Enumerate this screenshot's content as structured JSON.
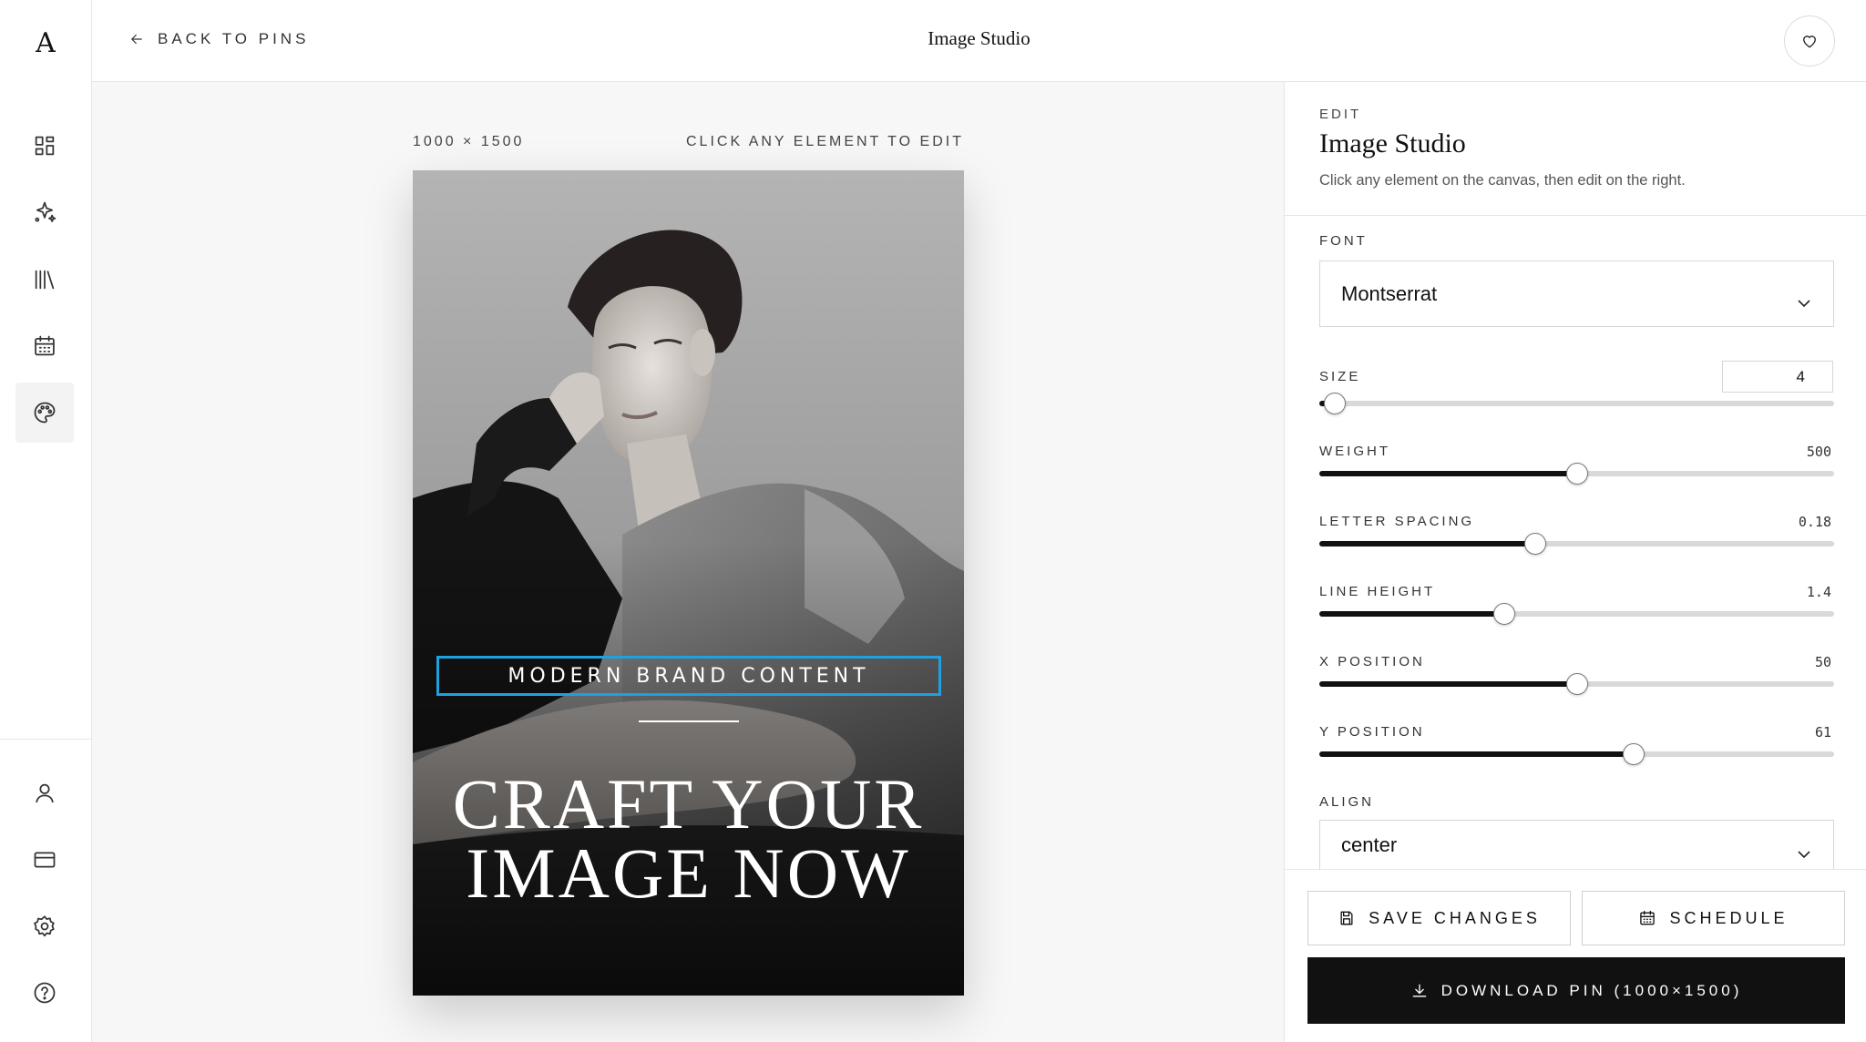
{
  "app": {
    "logo": "A",
    "title": "Image Studio",
    "back_label": "BACK TO PINS"
  },
  "sidebar": {
    "items": [
      {
        "name": "dashboard",
        "icon": "grid-icon"
      },
      {
        "name": "ai-generate",
        "icon": "sparkles-icon"
      },
      {
        "name": "library",
        "icon": "library-icon"
      },
      {
        "name": "calendar",
        "icon": "calendar-icon"
      },
      {
        "name": "image-studio",
        "icon": "palette-icon",
        "active": true
      }
    ],
    "bottom_items": [
      {
        "name": "profile",
        "icon": "user-icon"
      },
      {
        "name": "billing",
        "icon": "credit-card-icon"
      },
      {
        "name": "settings",
        "icon": "gear-icon"
      },
      {
        "name": "help",
        "icon": "help-icon"
      }
    ]
  },
  "canvas": {
    "size_label": "1000 × 1500",
    "hint": "CLICK ANY ELEMENT TO EDIT",
    "pin": {
      "subtitle": "MODERN BRAND CONTENT",
      "headline_line1": "CRAFT YOUR",
      "headline_line2": "IMAGE NOW",
      "selection_color": "#1da1e0"
    }
  },
  "panel": {
    "eyebrow": "EDIT",
    "title": "Image Studio",
    "description": "Click any element on the canvas, then edit on the right.",
    "font": {
      "label": "FONT",
      "value": "Montserrat"
    },
    "size": {
      "label": "SIZE",
      "value": "4",
      "fraction": 0.03
    },
    "weight": {
      "label": "WEIGHT",
      "value": "500",
      "fraction": 0.5
    },
    "letter_spacing": {
      "label": "LETTER SPACING",
      "value": "0.18",
      "fraction": 0.42
    },
    "line_height": {
      "label": "LINE HEIGHT",
      "value": "1.4",
      "fraction": 0.36
    },
    "x_position": {
      "label": "X POSITION",
      "value": "50",
      "fraction": 0.5
    },
    "y_position": {
      "label": "Y POSITION",
      "value": "61",
      "fraction": 0.61
    },
    "align": {
      "label": "ALIGN",
      "value": "center"
    },
    "save_label": "SAVE CHANGES",
    "schedule_label": "SCHEDULE",
    "download_label": "DOWNLOAD PIN (1000×1500)"
  }
}
